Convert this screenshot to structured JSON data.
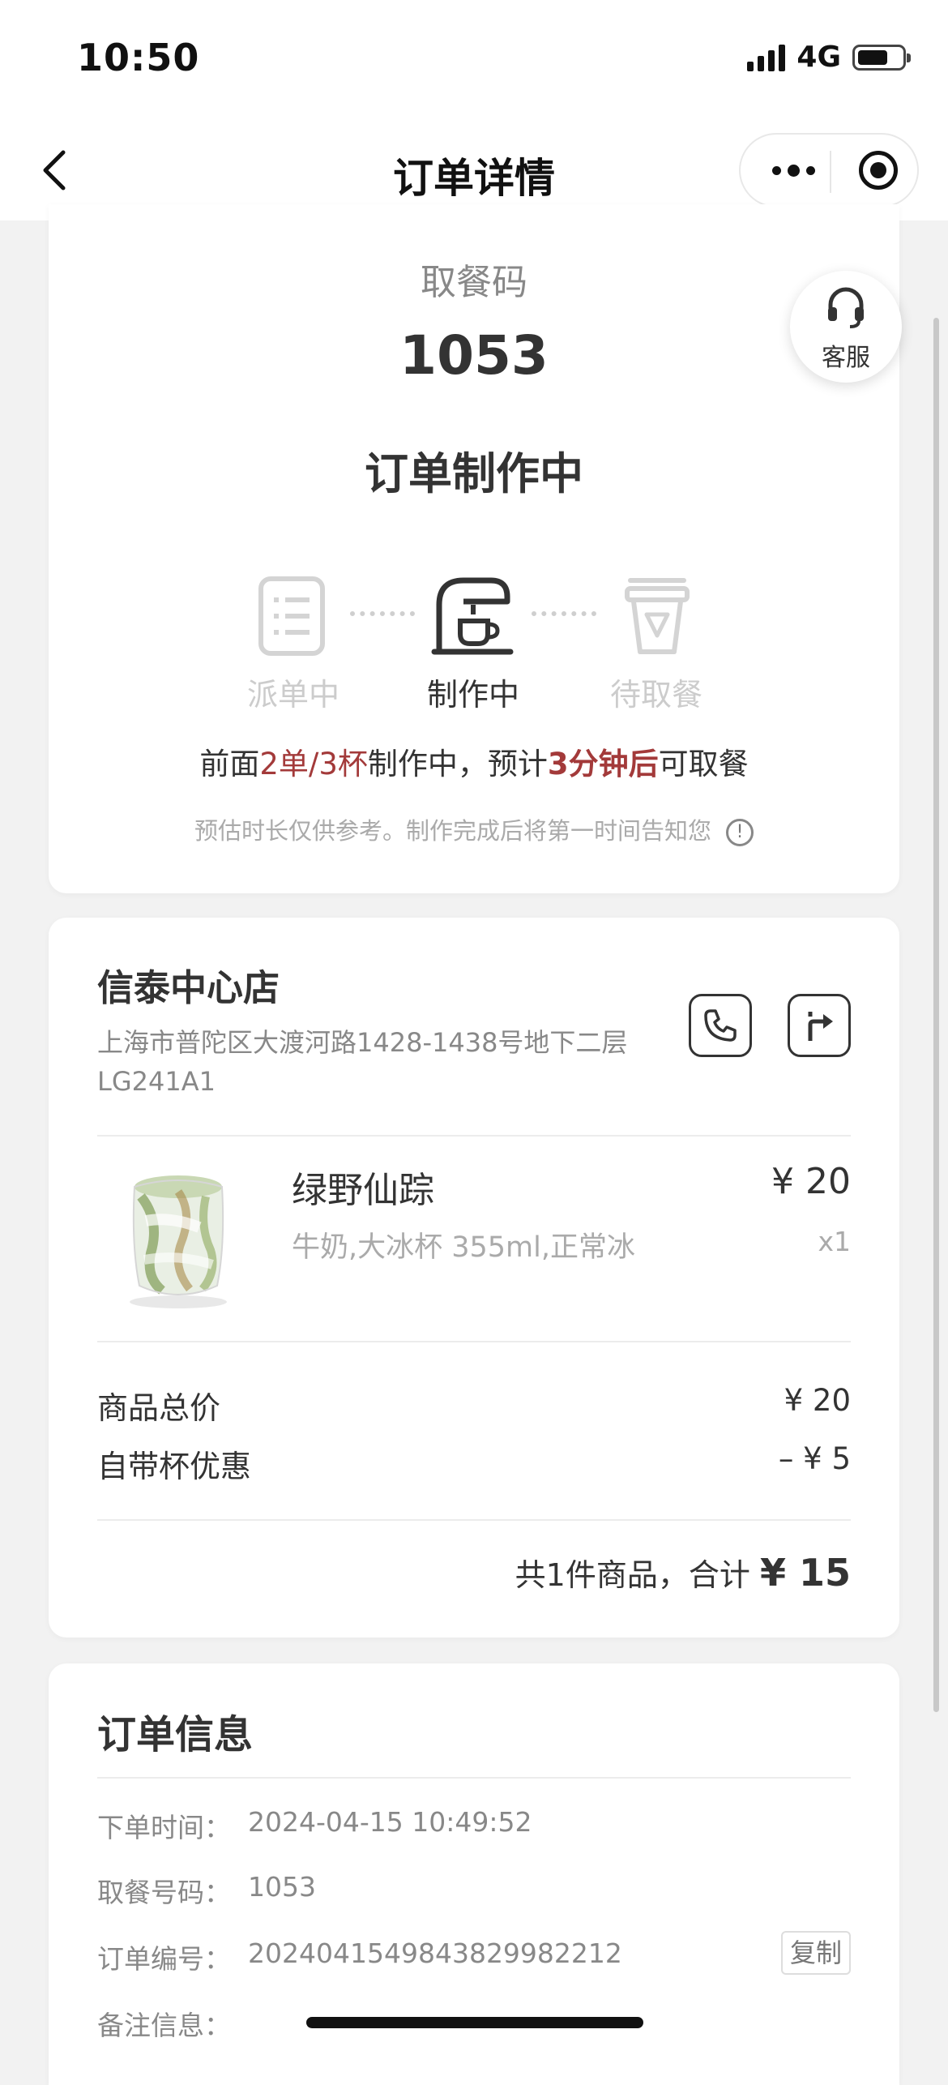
{
  "status_bar": {
    "time": "10:50",
    "network": "4G"
  },
  "nav": {
    "title": "订单详情"
  },
  "customer_service": {
    "label": "客服"
  },
  "pickup": {
    "label": "取餐码",
    "code": "1053",
    "status": "订单制作中"
  },
  "steps": [
    {
      "label": "派单中",
      "icon": "clipboard-list-icon",
      "active": false
    },
    {
      "label": "制作中",
      "icon": "coffee-machine-icon",
      "active": true
    },
    {
      "label": "待取餐",
      "icon": "cup-icon",
      "active": false
    }
  ],
  "estimate": {
    "prefix": "前面",
    "queue": "2单/3杯",
    "middle": "制作中，预计",
    "time": "3分钟后",
    "suffix": "可取餐",
    "note": "预估时长仅供参考。制作完成后将第一时间告知您"
  },
  "store": {
    "name": "信泰中心店",
    "address": "上海市普陀区大渡河路1428-1438号地下二层LG241A1"
  },
  "product": {
    "name": "绿野仙踪",
    "spec": "牛奶,大冰杯 355ml,正常冰",
    "price": "¥ 20",
    "qty": "x1"
  },
  "price_rows": [
    {
      "label": "商品总价",
      "value": "¥ 20"
    },
    {
      "label": "自带杯优惠",
      "value": "–  ¥ 5"
    }
  ],
  "total": {
    "prefix": "共1件商品，合计",
    "amount": "¥ 15"
  },
  "order_info": {
    "title": "订单信息",
    "rows": [
      {
        "label": "下单时间：",
        "value": "2024-04-15 10:49:52"
      },
      {
        "label": "取餐号码：",
        "value": "1053"
      },
      {
        "label": "订单编号：",
        "value": "20240415498438299822​12"
      },
      {
        "label": "备注信息：",
        "value": ""
      }
    ],
    "copy_label": "复制"
  },
  "colors": {
    "accent_red": "#a33a3a",
    "background": "#f2f2f2",
    "card": "#ffffff"
  }
}
